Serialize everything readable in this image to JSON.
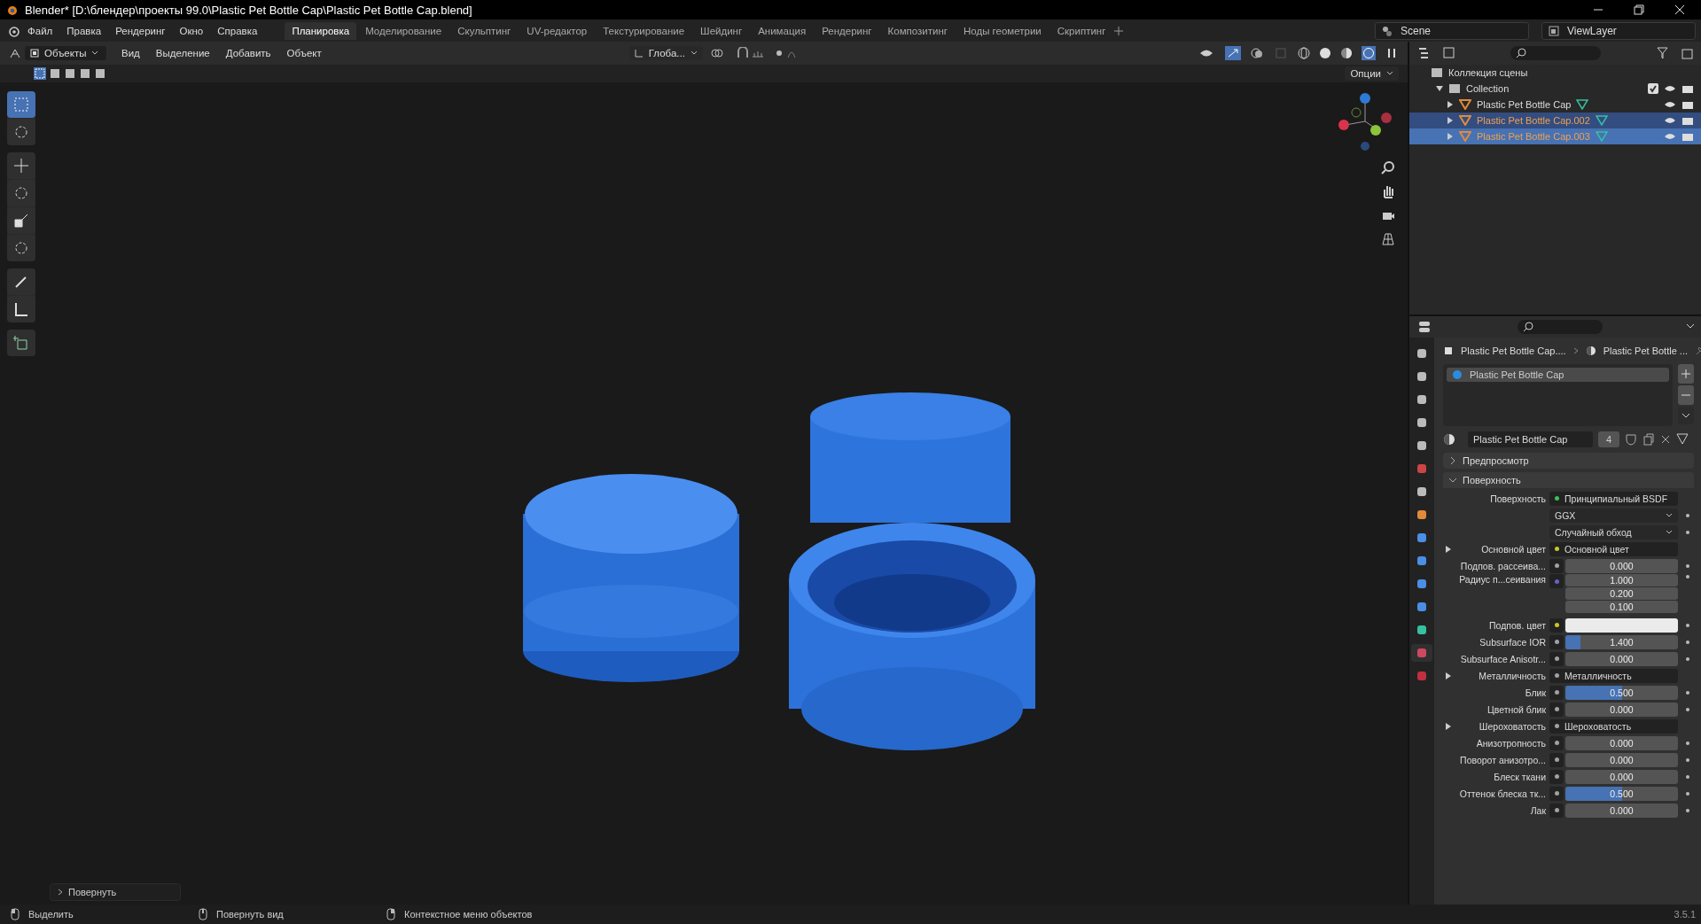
{
  "window": {
    "title": "Blender* [D:\\блендер\\проекты 99.0\\Plastic Pet Bottle Cap\\Plastic Pet Bottle Cap.blend]"
  },
  "menu": [
    "Файл",
    "Правка",
    "Рендеринг",
    "Окно",
    "Справка"
  ],
  "workspaces": [
    {
      "label": "Планировка",
      "selected": true
    },
    {
      "label": "Моделирование",
      "selected": false
    },
    {
      "label": "Скульптинг",
      "selected": false
    },
    {
      "label": "UV-редактор",
      "selected": false
    },
    {
      "label": "Текстурирование",
      "selected": false
    },
    {
      "label": "Шейдинг",
      "selected": false
    },
    {
      "label": "Анимация",
      "selected": false
    },
    {
      "label": "Рендеринг",
      "selected": false
    },
    {
      "label": "Композитинг",
      "selected": false
    },
    {
      "label": "Ноды геометрии",
      "selected": false
    },
    {
      "label": "Скриптинг",
      "selected": false
    }
  ],
  "scene": "Scene",
  "view_layer": "ViewLayer",
  "viewport": {
    "mode": "Объекты",
    "menus": [
      "Вид",
      "Выделение",
      "Добавить",
      "Объект"
    ],
    "orientation": "Глоба...",
    "options": "Опции",
    "last_operator": "Повернуть"
  },
  "outliner": {
    "root": "Коллекция сцены",
    "collection": "Collection",
    "items": [
      {
        "name": "Plastic Pet Bottle Cap",
        "selected": false,
        "active": false
      },
      {
        "name": "Plastic Pet Bottle Cap.002",
        "selected": true,
        "active": false
      },
      {
        "name": "Plastic Pet Bottle Cap.003",
        "selected": true,
        "active": true
      }
    ]
  },
  "properties": {
    "tabs": [
      {
        "selected": false
      },
      {
        "selected": false
      },
      {
        "selected": false
      },
      {
        "selected": false
      },
      {
        "selected": false
      },
      {
        "selected": false
      },
      {
        "selected": false
      },
      {
        "selected": false
      },
      {
        "selected": false
      },
      {
        "selected": false
      },
      {
        "selected": false
      },
      {
        "selected": false
      },
      {
        "selected": false
      },
      {
        "selected": true
      },
      {
        "selected": false
      }
    ],
    "breadcrumb": [
      "Plastic Pet Bottle Cap....",
      "Plastic Pet Bottle ..."
    ],
    "slots": [
      {
        "name": "Plastic Pet Bottle Cap",
        "selected": true
      }
    ],
    "material": "Plastic Pet Bottle Cap",
    "users": "4",
    "panels": [
      {
        "title": "Предпросмотр",
        "expanded": false
      },
      {
        "title": "Поверхность",
        "expanded": true,
        "rows": [
          {
            "kind": "link",
            "label": "Поверхность",
            "value": "Принципиальный BSDF",
            "color": "#3fbf5a",
            "expandable": false
          },
          {
            "kind": "dropdown",
            "value": "GGX"
          },
          {
            "kind": "dropdown",
            "value": "Случайный обход"
          },
          {
            "kind": "link",
            "label": "Основной цвет",
            "value": "Основной цвет",
            "color": "#c7c729",
            "expandable": true
          },
          {
            "kind": "value",
            "label": "Подпов. рассеива...",
            "value": "0.000",
            "level": 0,
            "color": "#a1a1a1"
          },
          {
            "kind": "vector",
            "label": "Радиус п...сеивания",
            "values": [
              "1.000",
              "0.200",
              "0.100"
            ],
            "color": "#6363c7"
          },
          {
            "kind": "color",
            "label": "Подпов. цвет",
            "color": "#c7c729"
          },
          {
            "kind": "value",
            "label": "Subsurface IOR",
            "value": "1.400",
            "level": 0.13,
            "color": "#a1a1a1"
          },
          {
            "kind": "value",
            "label": "Subsurface Anisotr...",
            "value": "0.000",
            "level": 0,
            "color": "#a1a1a1"
          },
          {
            "kind": "link",
            "label": "Металличность",
            "value": "Металличность",
            "color": "#a1a1a1",
            "expandable": true
          },
          {
            "kind": "value",
            "label": "Блик",
            "value": "0.500",
            "level": 0.5,
            "color": "#a1a1a1"
          },
          {
            "kind": "value",
            "label": "Цветной блик",
            "value": "0.000",
            "level": 0,
            "color": "#a1a1a1"
          },
          {
            "kind": "link",
            "label": "Шероховатость",
            "value": "Шероховатость",
            "color": "#a1a1a1",
            "expandable": true
          },
          {
            "kind": "value",
            "label": "Анизотропность",
            "value": "0.000",
            "level": 0,
            "color": "#a1a1a1"
          },
          {
            "kind": "value",
            "label": "Поворот анизотро...",
            "value": "0.000",
            "level": 0,
            "color": "#a1a1a1"
          },
          {
            "kind": "value",
            "label": "Блеск ткани",
            "value": "0.000",
            "level": 0,
            "color": "#a1a1a1"
          },
          {
            "kind": "value",
            "label": "Оттенок блеска тк...",
            "value": "0.500",
            "level": 0.5,
            "color": "#a1a1a1"
          },
          {
            "kind": "value",
            "label": "Лак",
            "value": "0.000",
            "level": 0,
            "color": "#a1a1a1"
          }
        ]
      }
    ]
  },
  "status_bar": {
    "hints": [
      "Выделить",
      "Повернуть вид",
      "Контекстное меню объектов"
    ],
    "version": "3.5.1"
  }
}
